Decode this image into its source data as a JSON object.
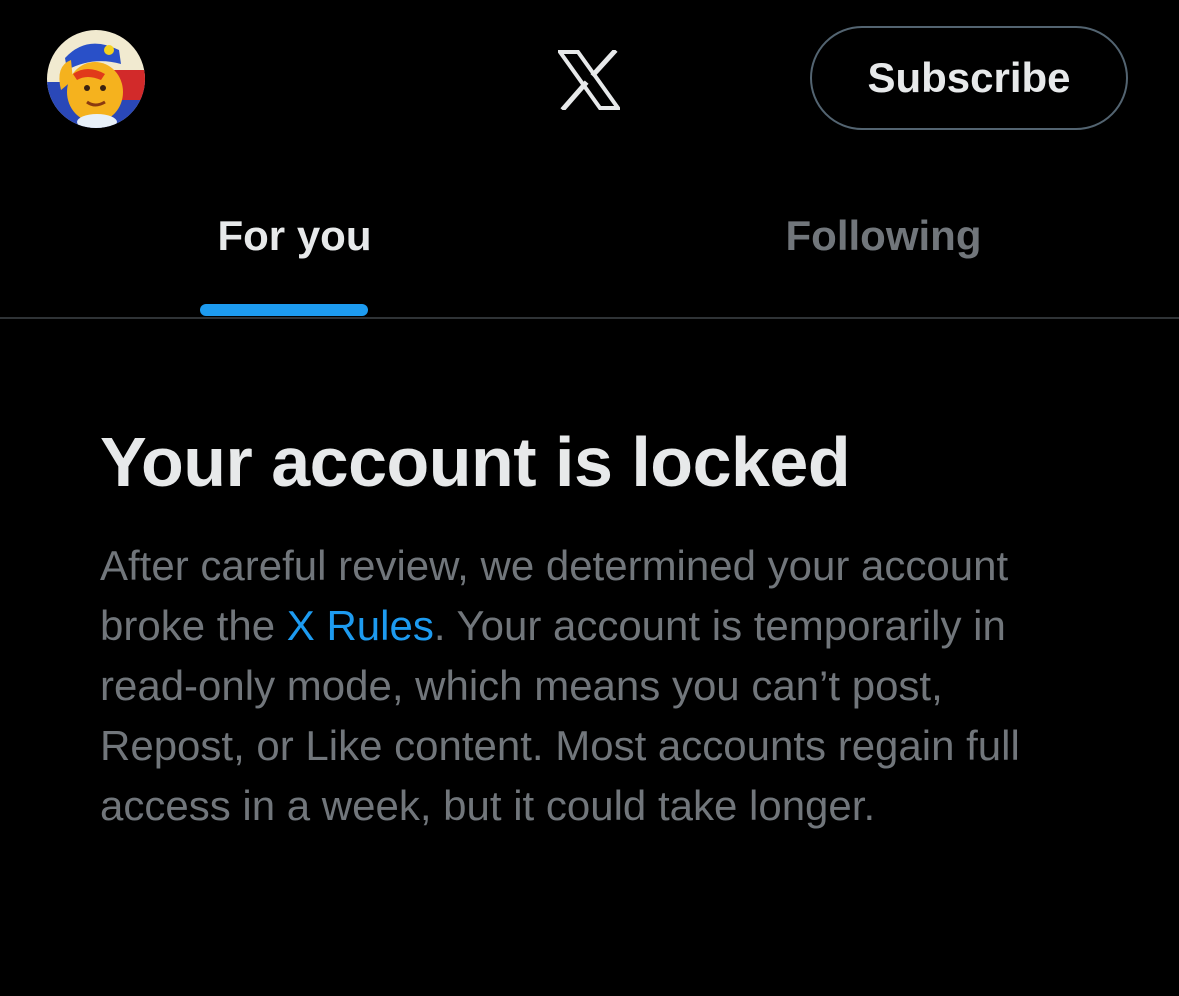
{
  "header": {
    "avatar_icon": "user-avatar-icon",
    "logo_icon": "x-logo-icon",
    "subscribe_label": "Subscribe"
  },
  "tabs": [
    {
      "label": "For you",
      "active": true
    },
    {
      "label": "Following",
      "active": false
    }
  ],
  "notice": {
    "title": "Your account is locked",
    "body_before_link": "After careful review, we determined your account broke the ",
    "link_text": "X Rules",
    "body_after_link": ". Your account is temporarily in read-only mode, which means you can’t post, Repost, or Like content. Most accounts regain full access in a week, but it could take longer."
  },
  "colors": {
    "background": "#000000",
    "primary_text": "#e7e9ea",
    "secondary_text": "#71767b",
    "accent": "#1d9bf0",
    "border": "#536471",
    "divider": "#2f3336"
  }
}
